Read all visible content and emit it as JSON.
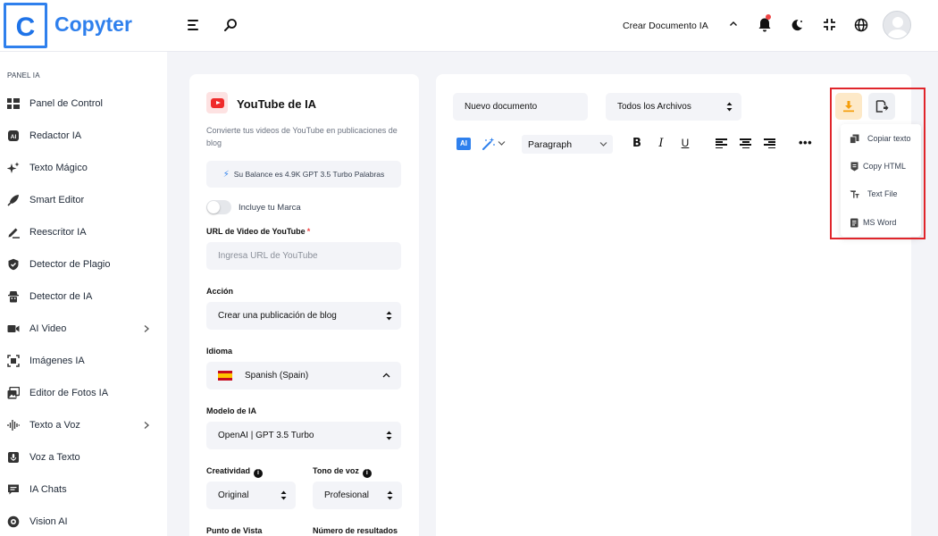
{
  "app": {
    "logo_letter": "C",
    "logo_text": "Copyter"
  },
  "header": {
    "create_document": "Crear Documento IA"
  },
  "sidebar": {
    "heading": "PANEL IA",
    "items": [
      {
        "label": "Panel de Control",
        "icon": "grid-icon"
      },
      {
        "label": "Redactor IA",
        "icon": "ai-writer-icon"
      },
      {
        "label": "Texto Mágico",
        "icon": "sparkle-icon"
      },
      {
        "label": "Smart Editor",
        "icon": "pen-nib-icon"
      },
      {
        "label": "Reescritor IA",
        "icon": "pencil-icon"
      },
      {
        "label": "Detector de Plagio",
        "icon": "shield-icon"
      },
      {
        "label": "Detector de IA",
        "icon": "detective-icon"
      },
      {
        "label": "AI Video",
        "icon": "video-icon"
      },
      {
        "label": "Imágenes IA",
        "icon": "image-scan-icon"
      },
      {
        "label": "Editor de Fotos IA",
        "icon": "photo-editor-icon"
      },
      {
        "label": "Texto a Voz",
        "icon": "waveform-icon"
      },
      {
        "label": "Voz a Texto",
        "icon": "voice-to-text-icon"
      },
      {
        "label": "IA Chats",
        "icon": "chat-icon"
      },
      {
        "label": "Vision AI",
        "icon": "vision-icon"
      }
    ]
  },
  "panel": {
    "title": "YouTube de IA",
    "description": "Convierte tus videos de YouTube en publicaciones de blog",
    "balance": "Su Balance es 4.9K GPT 3.5 Turbo Palabras",
    "brand_toggle_label": "Incluye tu Marca",
    "url_label": "URL de Video de YouTube",
    "url_required": "*",
    "url_placeholder": "Ingresa URL de YouTube",
    "action_label": "Acción",
    "action_value": "Crear una publicación de blog",
    "language_label": "Idioma",
    "language_value": "Spanish (Spain)",
    "model_label": "Modelo de IA",
    "model_value": "OpenAI | GPT 3.5 Turbo",
    "creativity_label": "Creatividad",
    "creativity_value": "Original",
    "tone_label": "Tono de voz",
    "tone_value": "Profesional",
    "pov_label": "Punto de Vista",
    "results_label": "Número de resultados"
  },
  "editor": {
    "doc_name": "Nuevo documento",
    "folder_value": "Todos los Archivos",
    "ai_chip": "AI",
    "paragraph": "Paragraph",
    "bold": "B",
    "italic": "I",
    "underline": "U",
    "more": "•••",
    "download_menu": [
      {
        "label": "Copiar texto",
        "icon": "copy-icon"
      },
      {
        "label": "Copy HTML",
        "icon": "html-file-icon"
      },
      {
        "label": "Text File",
        "icon": "text-format-icon"
      },
      {
        "label": "MS Word",
        "icon": "word-file-icon"
      }
    ]
  },
  "colors": {
    "brand": "#2f80ed",
    "highlight": "#e0252b",
    "download_bg": "#fde9c8",
    "youtube_red": "#ef2b2b"
  }
}
